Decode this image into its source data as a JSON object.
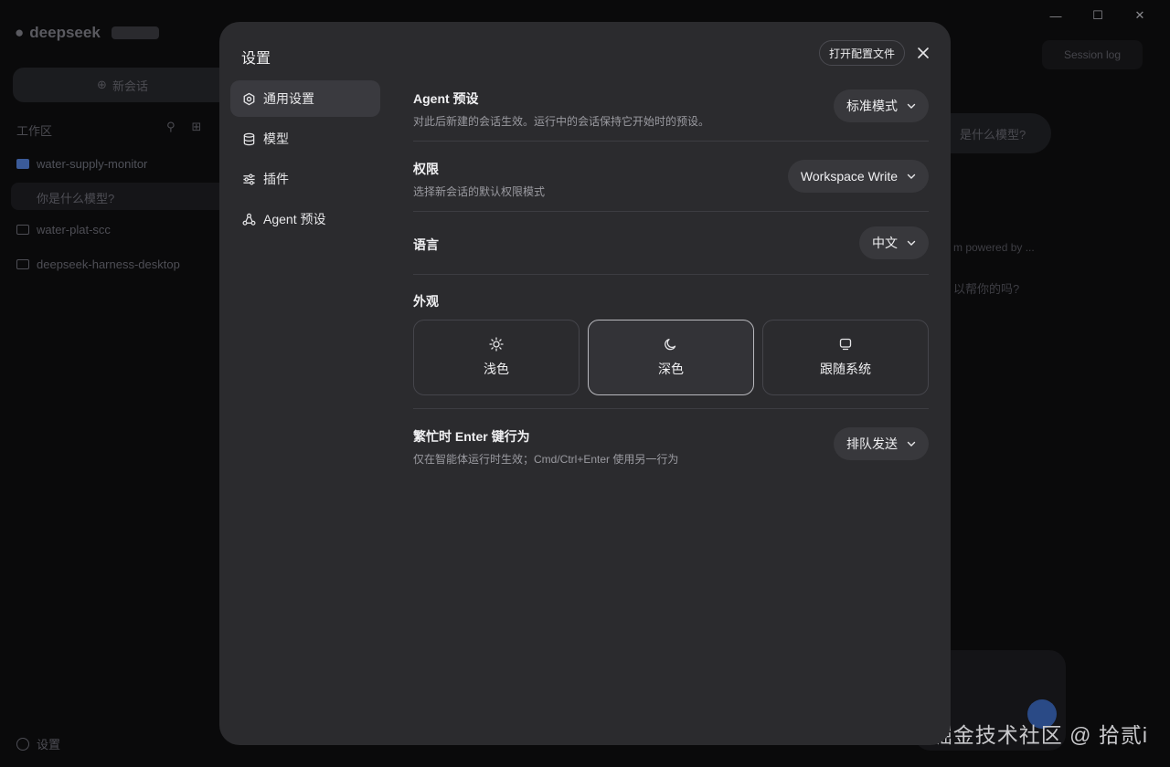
{
  "background": {
    "logo_text": "deepseek",
    "new_chat_label": "新会话",
    "section_label": "工作区",
    "workspaces": [
      "water-supply-monitor",
      "water-plat-scc",
      "deepseek-harness-desktop"
    ],
    "active_thread": "你是什么模型?",
    "settings_label": "设置",
    "session_log_label": "Session log",
    "bubble_text": "是什么模型?",
    "bg_line_1": "m powered by ...",
    "bg_line_2": "以帮你的吗?"
  },
  "modal": {
    "title": "设置",
    "open_config_label": "打开配置文件",
    "nav": [
      {
        "label": "通用设置",
        "icon": "gear-icon",
        "active": true
      },
      {
        "label": "模型",
        "icon": "database-icon",
        "active": false
      },
      {
        "label": "插件",
        "icon": "sliders-icon",
        "active": false
      },
      {
        "label": "Agent 预设",
        "icon": "agent-icon",
        "active": false
      }
    ],
    "agent_preset": {
      "title": "Agent 预设",
      "desc": "对此后新建的会话生效。运行中的会话保持它开始时的预设。",
      "value": "标准模式"
    },
    "permission": {
      "title": "权限",
      "desc": "选择新会话的默认权限模式",
      "value": "Workspace Write"
    },
    "language": {
      "title": "语言",
      "value": "中文"
    },
    "appearance": {
      "title": "外观",
      "options": [
        {
          "label": "浅色",
          "icon": "sun-icon",
          "selected": false
        },
        {
          "label": "深色",
          "icon": "moon-icon",
          "selected": true
        },
        {
          "label": "跟随系统",
          "icon": "monitor-icon",
          "selected": false
        }
      ]
    },
    "busy_enter": {
      "title": "繁忙时 Enter 键行为",
      "desc": "仅在智能体运行时生效；Cmd/Ctrl+Enter 使用另一行为",
      "value": "排队发送"
    }
  },
  "watermark": "掘金技术社区 @ 拾贰i"
}
